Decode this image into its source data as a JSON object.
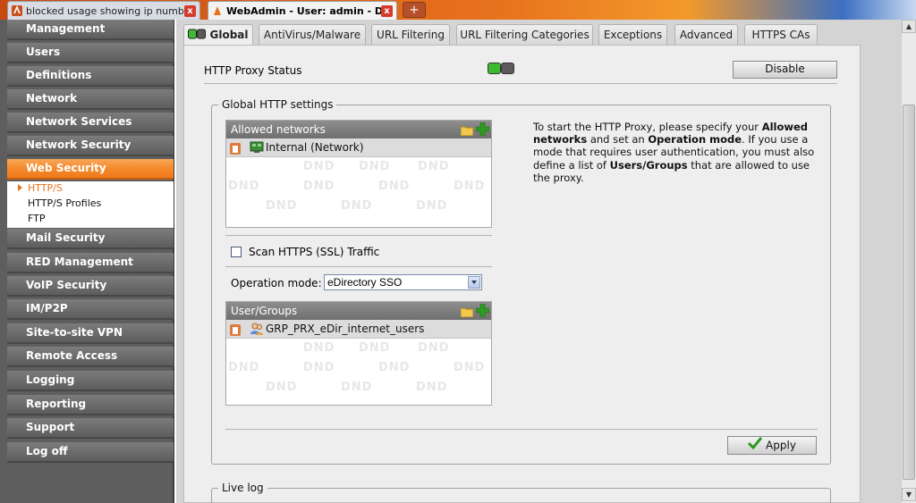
{
  "browser": {
    "tabs": [
      {
        "title": "blocked usage showing ip numbers - As..."
      },
      {
        "title": "WebAdmin - User: admin - Devic..."
      }
    ],
    "new_tab_label": "+",
    "close_label": "x"
  },
  "sidebar": {
    "items": [
      {
        "label": "Management"
      },
      {
        "label": "Users"
      },
      {
        "label": "Definitions"
      },
      {
        "label": "Network"
      },
      {
        "label": "Network Services"
      },
      {
        "label": "Network Security"
      },
      {
        "label": "Web Security"
      },
      {
        "label": "Mail Security"
      },
      {
        "label": "RED Management"
      },
      {
        "label": "VoIP Security"
      },
      {
        "label": "IM/P2P"
      },
      {
        "label": "Site-to-site VPN"
      },
      {
        "label": "Remote Access"
      },
      {
        "label": "Logging"
      },
      {
        "label": "Reporting"
      },
      {
        "label": "Support"
      },
      {
        "label": "Log off"
      }
    ],
    "subitems": [
      {
        "label": "HTTP/S"
      },
      {
        "label": "HTTP/S Profiles"
      },
      {
        "label": "FTP"
      }
    ]
  },
  "tabs": [
    {
      "label": "Global"
    },
    {
      "label": "AntiVirus/Malware"
    },
    {
      "label": "URL Filtering"
    },
    {
      "label": "URL Filtering Categories"
    },
    {
      "label": "Exceptions"
    },
    {
      "label": "Advanced"
    },
    {
      "label": "HTTPS CAs"
    }
  ],
  "status": {
    "label": "HTTP Proxy Status",
    "disable_button": "Disable"
  },
  "global_settings": {
    "legend": "Global HTTP settings",
    "allowed_networks": {
      "header": "Allowed networks",
      "items": [
        {
          "label": "Internal (Network)"
        }
      ]
    },
    "scan_https_label": "Scan HTTPS (SSL) Traffic",
    "operation_mode_label": "Operation mode:",
    "operation_mode_value": "eDirectory SSO",
    "user_groups": {
      "header": "User/Groups",
      "items": [
        {
          "label": "GRP_PRX_eDir_internet_users"
        }
      ]
    },
    "watermark": "DND",
    "apply_button": "Apply",
    "help_text": {
      "p1": "To start the HTTP Proxy, please specify your",
      "b1": "Allowed networks",
      "p2": " and set an ",
      "b2": "Operation mode",
      "p3": ". If you use a mode that requires user authentication, you must also define a list of ",
      "b3": "Users/Groups",
      "p4": " that are allowed to use the proxy."
    }
  },
  "live_log": {
    "legend": "Live log"
  },
  "colors": {
    "accent": "#f58a2c",
    "nav_bg": "#5e5e5e",
    "led_on": "#3dbb2f",
    "led_off": "#5a5a5a",
    "add_icon": "#2f9a22"
  }
}
